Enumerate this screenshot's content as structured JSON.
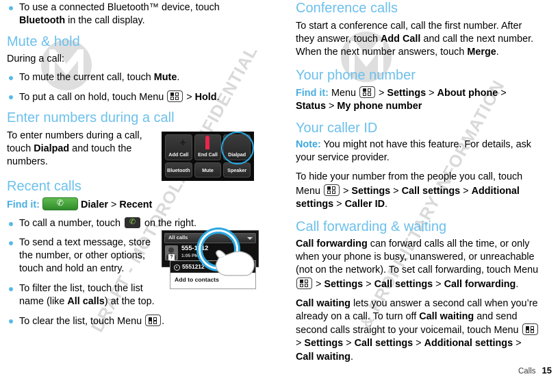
{
  "watermark": {
    "line1": "DRAFT - MOTOROLA CONFIDENTIAL",
    "line2": "& PROPRIETARY INFORMATION",
    "logo_name": "motorola-batwing-logo"
  },
  "footer": {
    "chapter": "Calls",
    "page": "15"
  },
  "left_column": {
    "top_bullets": [
      {
        "parts": [
          {
            "t": "To use a connected Bluetooth™ device, touch ",
            "s": "n"
          },
          {
            "t": "Bluetooth",
            "s": "b"
          },
          {
            "t": " in the call display.",
            "s": "n"
          }
        ]
      }
    ],
    "mute_hold": {
      "heading": "Mute & hold",
      "intro": "During a call:",
      "bullets": [
        {
          "parts": [
            {
              "t": "To mute the current call, touch ",
              "s": "n"
            },
            {
              "t": "Mute",
              "s": "b"
            },
            {
              "t": ".",
              "s": "n"
            }
          ]
        },
        {
          "parts": [
            {
              "t": "To put a call on hold, touch Menu ",
              "s": "n"
            },
            {
              "t": "",
              "s": "menu"
            },
            {
              "t": " > ",
              "s": "n"
            },
            {
              "t": "Hold",
              "s": "b"
            },
            {
              "t": ".",
              "s": "n"
            }
          ]
        }
      ]
    },
    "enter_numbers": {
      "heading": "Enter numbers during a call",
      "paragraph": [
        {
          "t": "To enter numbers during a call, touch ",
          "s": "n"
        },
        {
          "t": "Dialpad",
          "s": "b"
        },
        {
          "t": " and touch the numbers.",
          "s": "n"
        }
      ]
    },
    "recent_calls": {
      "heading": "Recent calls",
      "find_it_label": "Find it:",
      "find_it_path": [
        {
          "t": "",
          "s": "dialer"
        },
        {
          "t": "Dialer",
          "s": "b"
        },
        {
          "t": " > ",
          "s": "n"
        },
        {
          "t": "Recent",
          "s": "b"
        }
      ],
      "bullets": [
        {
          "parts": [
            {
              "t": "To call a number, touch ",
              "s": "n"
            },
            {
              "t": "",
              "s": "phone"
            },
            {
              "t": " on the right.",
              "s": "n"
            }
          ]
        },
        {
          "parts": [
            {
              "t": "To send a text message, store the number, or other options, touch and hold an entry.",
              "s": "n"
            }
          ]
        },
        {
          "parts": [
            {
              "t": "To filter the list, touch the list name (like ",
              "s": "n"
            },
            {
              "t": "All calls",
              "s": "b"
            },
            {
              "t": ") at the top.",
              "s": "n"
            }
          ]
        },
        {
          "parts": [
            {
              "t": "To clear the list, touch Menu ",
              "s": "n"
            },
            {
              "t": "",
              "s": "menu"
            },
            {
              "t": ".",
              "s": "n"
            }
          ]
        }
      ]
    }
  },
  "right_column": {
    "conference": {
      "heading": "Conference calls",
      "paragraph": [
        {
          "t": "To start a conference call, call the first number. After they answer, touch ",
          "s": "n"
        },
        {
          "t": "Add Call",
          "s": "b"
        },
        {
          "t": " and call the next number. When the next number answers, touch ",
          "s": "n"
        },
        {
          "t": "Merge",
          "s": "b"
        },
        {
          "t": ".",
          "s": "n"
        }
      ]
    },
    "phone_number": {
      "heading": "Your phone number",
      "find_it_label": "Find it:",
      "find_it_path": [
        {
          "t": " Menu ",
          "s": "n"
        },
        {
          "t": "",
          "s": "menu"
        },
        {
          "t": " > ",
          "s": "n"
        },
        {
          "t": "Settings",
          "s": "b"
        },
        {
          "t": " > ",
          "s": "n"
        },
        {
          "t": "About phone",
          "s": "b"
        },
        {
          "t": " > ",
          "s": "n"
        },
        {
          "t": "Status",
          "s": "b"
        },
        {
          "t": " > ",
          "s": "n"
        },
        {
          "t": "My phone number",
          "s": "b"
        }
      ]
    },
    "caller_id": {
      "heading": "Your caller ID",
      "note_label": "Note:",
      "note_text": " You might not have this feature. For details, ask your service provider.",
      "paragraph": [
        {
          "t": "To hide your number from the people you call, touch Menu ",
          "s": "n"
        },
        {
          "t": "",
          "s": "menu"
        },
        {
          "t": " > ",
          "s": "n"
        },
        {
          "t": "Settings",
          "s": "b"
        },
        {
          "t": " > ",
          "s": "n"
        },
        {
          "t": "Call settings",
          "s": "b"
        },
        {
          "t": " > ",
          "s": "n"
        },
        {
          "t": "Additional settings",
          "s": "b"
        },
        {
          "t": " > ",
          "s": "n"
        },
        {
          "t": "Caller ID",
          "s": "b"
        },
        {
          "t": ".",
          "s": "n"
        }
      ]
    },
    "forwarding": {
      "heading": "Call forwarding & waiting",
      "paragraph_1": [
        {
          "t": "Call forwarding",
          "s": "b"
        },
        {
          "t": " can forward calls all the time, or only when your phone is busy, unanswered, or unreachable (not on the network). To set call forwarding, touch Menu ",
          "s": "n"
        },
        {
          "t": "",
          "s": "menu"
        },
        {
          "t": " > ",
          "s": "n"
        },
        {
          "t": "Settings",
          "s": "b"
        },
        {
          "t": " > ",
          "s": "n"
        },
        {
          "t": "Call settings",
          "s": "b"
        },
        {
          "t": " > ",
          "s": "n"
        },
        {
          "t": "Call forwarding",
          "s": "b"
        },
        {
          "t": ".",
          "s": "n"
        }
      ],
      "paragraph_2": [
        {
          "t": "Call waiting",
          "s": "b"
        },
        {
          "t": " lets you answer a second call when you’re already on a call. To turn off ",
          "s": "n"
        },
        {
          "t": "Call waiting",
          "s": "b"
        },
        {
          "t": " and send second calls straight to your voicemail, touch Menu ",
          "s": "n"
        },
        {
          "t": "",
          "s": "menu"
        },
        {
          "t": " > ",
          "s": "n"
        },
        {
          "t": "Settings",
          "s": "b"
        },
        {
          "t": " > ",
          "s": "n"
        },
        {
          "t": "Call settings",
          "s": "b"
        },
        {
          "t": " > ",
          "s": "n"
        },
        {
          "t": "Additional settings",
          "s": "b"
        },
        {
          "t": " > ",
          "s": "n"
        },
        {
          "t": "Call waiting",
          "s": "b"
        },
        {
          "t": ".",
          "s": "n"
        }
      ]
    }
  },
  "figure_call_controls": {
    "buttons": [
      {
        "label": "Add Call",
        "icon": "plus-icon",
        "highlighted": false
      },
      {
        "label": "End Call",
        "icon": "end-call-icon",
        "highlighted": false
      },
      {
        "label": "Dialpad",
        "icon": "dialpad-icon",
        "highlighted": true
      },
      {
        "label": "Bluetooth",
        "icon": "",
        "highlighted": false
      },
      {
        "label": "Mute",
        "icon": "",
        "highlighted": false
      },
      {
        "label": "Speaker",
        "icon": "",
        "highlighted": false
      }
    ],
    "highlight_color": "#29a8e0"
  },
  "figure_recent_calls": {
    "filter_label": "All calls",
    "entry": {
      "number": "555-1212",
      "time": "1:05 PM",
      "badge": "?"
    },
    "popup": {
      "number": "5551212",
      "menu_items": [
        "Add to contacts"
      ]
    },
    "gesture": "touch-and-hold"
  }
}
